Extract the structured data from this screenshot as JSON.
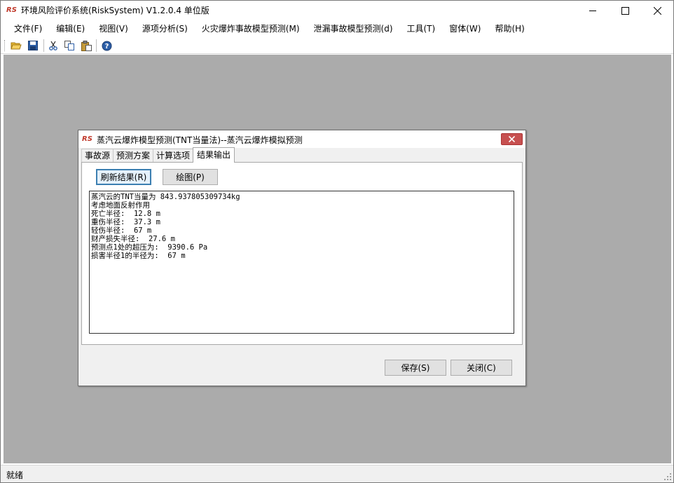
{
  "app": {
    "title": "环境风险评价系统(RiskSystem) V1.2.0.4 单位版",
    "icon": "app-logo-icon"
  },
  "menu": [
    "文件(F)",
    "编辑(E)",
    "视图(V)",
    "源项分析(S)",
    "火灾爆炸事故模型预测(M)",
    "泄漏事故模型预测(d)",
    "工具(T)",
    "窗体(W)",
    "帮助(H)"
  ],
  "toolbar": {
    "buttons": [
      "open-folder-icon",
      "save-icon",
      "cut-icon",
      "copy-icon",
      "paste-icon",
      "help-icon"
    ]
  },
  "dialog": {
    "title": "蒸汽云爆炸模型预测(TNT当量法)--蒸汽云爆炸模拟预测",
    "tabs": [
      "事故源",
      "预测方案",
      "计算选项",
      "结果输出"
    ],
    "active_tab": "结果输出",
    "refresh_button": "刷新结果(R)",
    "plot_button": "绘图(P)",
    "results": [
      "蒸汽云的TNT当量为 843.937805309734kg",
      "考虑地面反射作用",
      "死亡半径:  12.8 m",
      "重伤半径:  37.3 m",
      "轻伤半径:  67 m",
      "财产损失半径:  27.6 m",
      "预测点1处的超压为:  9390.6 Pa",
      "损害半径1的半径为:  67 m"
    ],
    "save_button": "保存(S)",
    "close_button": "关闭(C)"
  },
  "status": {
    "text": "就绪"
  },
  "colors": {
    "mdi_background": "#ababab",
    "dialog_close": "#c75050",
    "default_button_border": "#3c7fb1"
  }
}
